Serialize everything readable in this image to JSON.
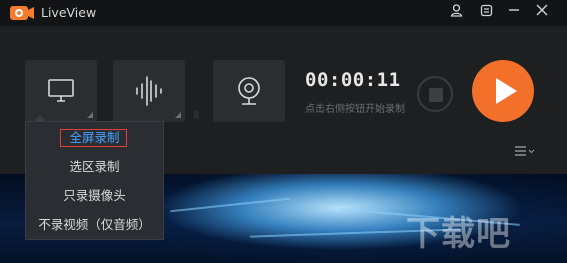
{
  "app": {
    "title": "LiveView"
  },
  "window_controls": {
    "user_icon": "user-icon",
    "settings_icon": "gear-icon",
    "minimize_icon": "minimize-icon",
    "close_icon": "close-icon"
  },
  "toolbar": {
    "screen_tile_icon": "monitor-icon",
    "audio_tile_icon": "audio-waveform-icon",
    "webcam_tile_icon": "webcam-icon"
  },
  "audio_level": 0.15,
  "timer": {
    "value": "00:00:11",
    "hint": "点击右侧按钮开始录制"
  },
  "buttons": {
    "stop_icon": "stop-icon",
    "record_icon": "play-icon",
    "menu_icon": "menu-icon"
  },
  "record_menu": {
    "items": [
      {
        "label": "全屏录制",
        "selected": true
      },
      {
        "label": "选区录制",
        "selected": false
      },
      {
        "label": "只录摄像头",
        "selected": false
      },
      {
        "label": "不录视频（仅音频）",
        "selected": false
      }
    ]
  },
  "watermark": {
    "text": "下载吧"
  },
  "colors": {
    "accent": "#f2702a",
    "selected": "#46a1ff",
    "highlight_box": "#e0403a"
  }
}
